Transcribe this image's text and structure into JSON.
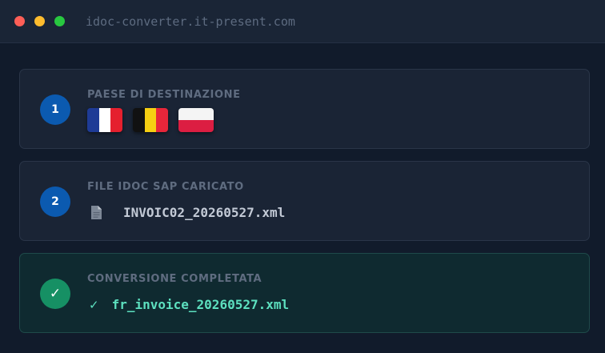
{
  "window": {
    "url": "idoc-converter.it-present.com"
  },
  "steps": [
    {
      "number": "1",
      "label": "PAESE DI DESTINAZIONE",
      "flags": [
        "france-flag",
        "belgium-flag",
        "poland-flag"
      ]
    },
    {
      "number": "2",
      "label": "FILE IDOC SAP CARICATO",
      "file_icon": "document-icon",
      "filename": "INVOIC02_20260527.xml"
    },
    {
      "badge_symbol": "✓",
      "label": "CONVERSIONE COMPLETATA",
      "check_symbol": "✓",
      "filename": "fr_invoice_20260527.xml"
    }
  ],
  "colors": {
    "background": "#111b2b",
    "accent_blue": "#0b5ab0",
    "success_green": "#169064",
    "success_text": "#5de0bf"
  }
}
